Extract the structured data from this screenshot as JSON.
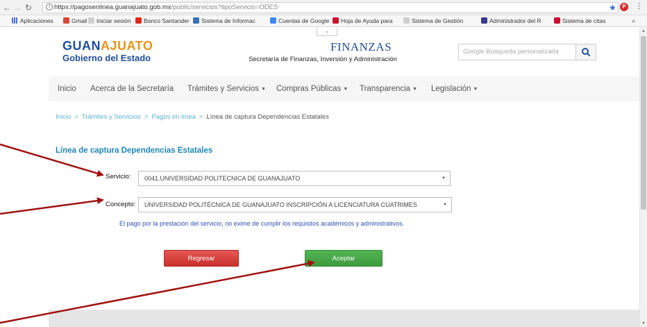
{
  "browser": {
    "url_host": "https://pagosenlinea.guanajuato.gob.mx",
    "url_path": "/public/servicios?tipoServicio=ODES",
    "bookmarks": [
      {
        "label": "Aplicaciones",
        "color": "#4a6fd1"
      },
      {
        "label": "Gmail",
        "color": "#d44638"
      },
      {
        "label": "Iniciar sesión",
        "color": "#cfcfcf"
      },
      {
        "label": "Banco Santander",
        "color": "#e2231a"
      },
      {
        "label": "Sistema de Informac",
        "color": "#3b6fb6"
      },
      {
        "label": "Cuentas de Google",
        "color": "#4285f4"
      },
      {
        "label": "Hoja de Ayuda para",
        "color": "#c8102e"
      },
      {
        "label": "Sistema de Gestión",
        "color": "#cfcfcf"
      },
      {
        "label": "Administrador del R",
        "color": "#3a3a8c"
      },
      {
        "label": "Sistema de citas",
        "color": "#c8102e"
      }
    ],
    "more": "»"
  },
  "header": {
    "logo_part1": "GUAN",
    "logo_part2": "AJUATO",
    "logo_sub": "Gobierno del Estado",
    "finanzas_title": "FINANZAS",
    "finanzas_sub": "Secretaría de Finanzas, Inversión y Administración",
    "search_placeholder": "Google Búsqueda personalizada"
  },
  "nav": {
    "items": [
      {
        "label": "Inicio",
        "dropdown": false
      },
      {
        "label": "Acerca de la Secretaría",
        "dropdown": false
      },
      {
        "label": "Trámites y Servicios",
        "dropdown": true
      },
      {
        "label": "Compras Públicas",
        "dropdown": true
      },
      {
        "label": "Transparencia",
        "dropdown": true
      },
      {
        "label": "Legislación",
        "dropdown": true
      }
    ]
  },
  "breadcrumb": {
    "items": [
      "Inicio",
      "Trámites y Servicios",
      "Pagos en línea"
    ],
    "current": "Línea de captura Dependencias Estatales",
    "separator": ">"
  },
  "form": {
    "title": "Línea de captura Dependencias Estatales",
    "servicio_label": "Servicio:",
    "servicio_value": "0041.UNIVERSIDAD POLITECNICA DE GUANAJUATO",
    "concepto_label": "Concepto:",
    "concepto_value": "UNIVERSIDAD POLITÉCNICA DE GUANAJUATO INSCRIPCIÓN A LICENCIATURA CUATRIMES",
    "notice": "El pago por la prestación del servicio, no exime de cumplir los requisitos académicos y administrativos.",
    "back_label": "Regresar",
    "accept_label": "Aceptar"
  },
  "colors": {
    "annotation_arrow": "#a01010",
    "brand_blue": "#1f4e9c",
    "brand_orange": "#e8941a",
    "link": "#5ab2cf",
    "accept": "#3d9b3d",
    "back": "#c9302c"
  }
}
